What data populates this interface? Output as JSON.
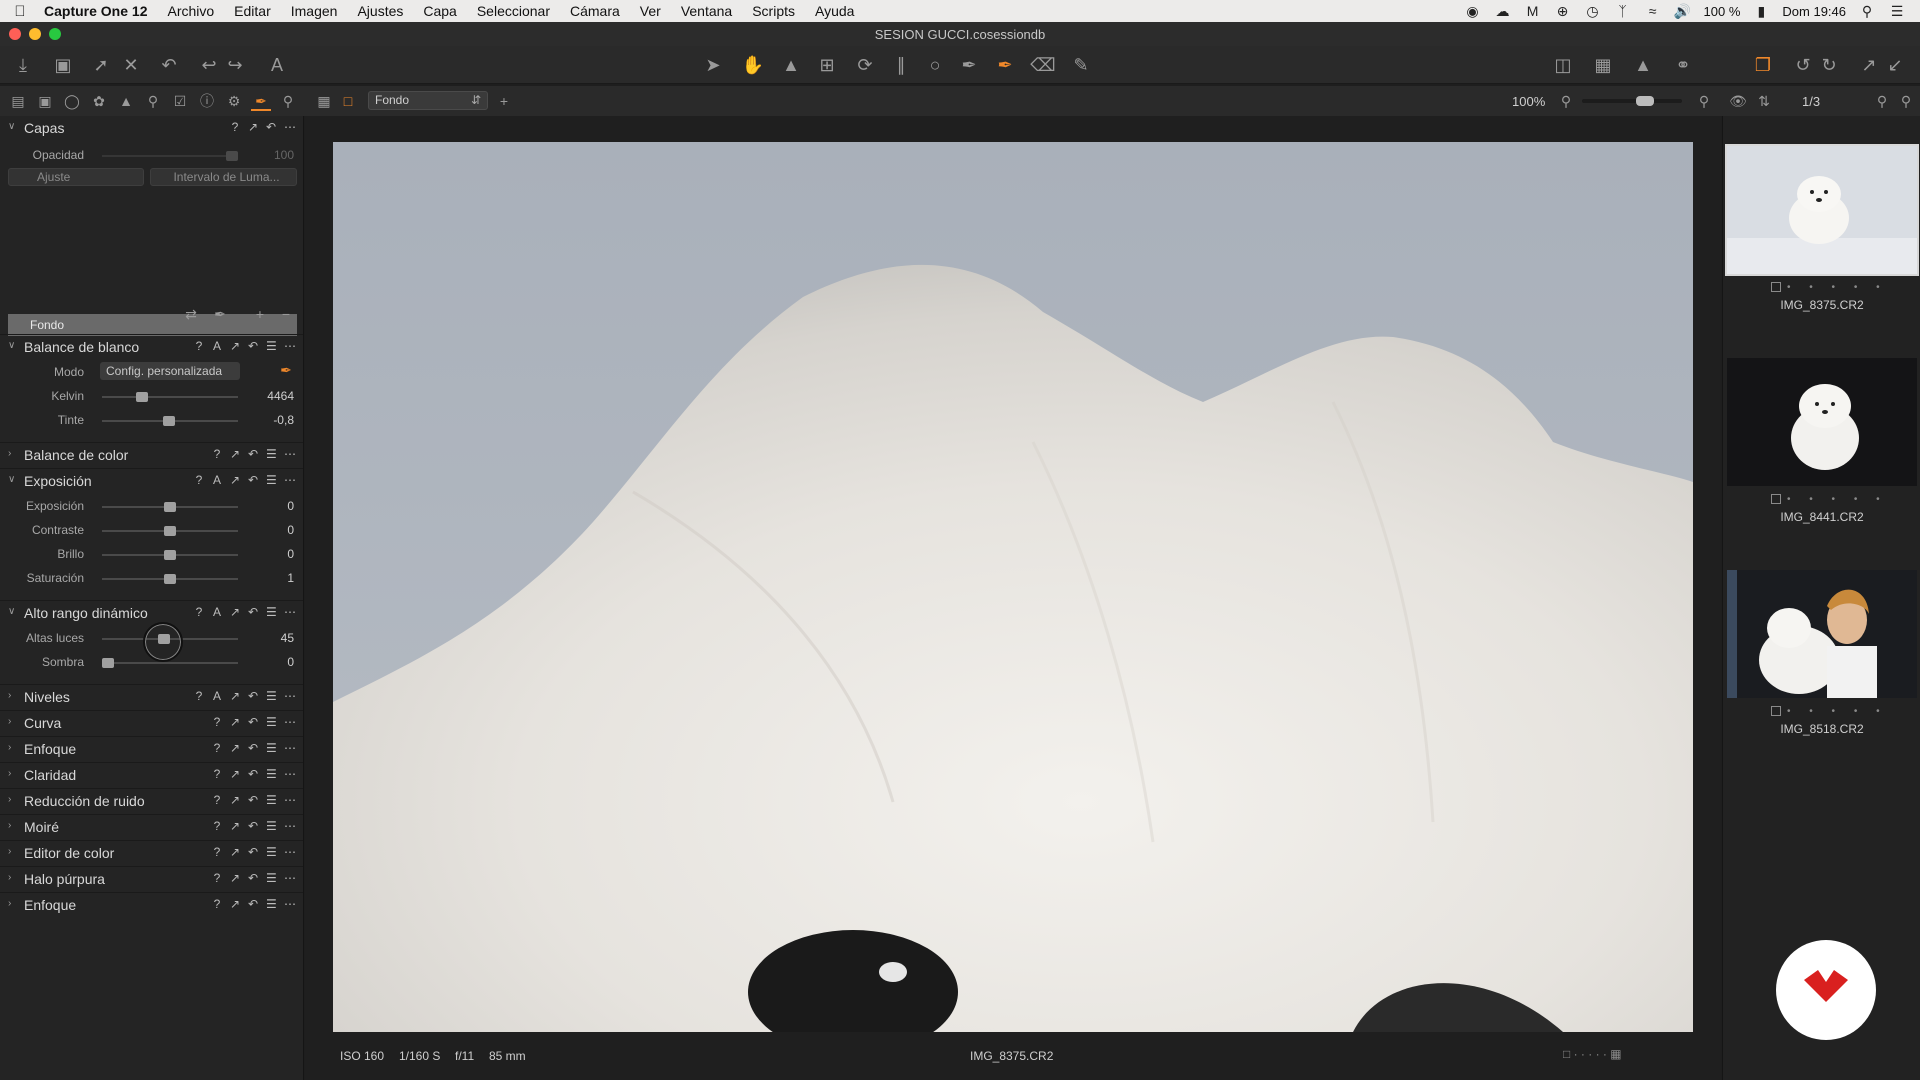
{
  "menubar": {
    "app_name": "Capture One 12",
    "items": [
      "Archivo",
      "Editar",
      "Imagen",
      "Ajustes",
      "Capa",
      "Seleccionar",
      "Cámara",
      "Ver",
      "Ventana",
      "Scripts",
      "Ayuda"
    ],
    "battery": "100 %",
    "clock": "Dom 19:46"
  },
  "window": {
    "title": "SESION GUCCI.cosessiondb"
  },
  "subbar": {
    "variant": "Fondo",
    "zoom": "100%",
    "counter": "1/3"
  },
  "panel": {
    "capas": {
      "title": "Capas",
      "opacity_label": "Opacidad",
      "opacity_value": "100",
      "adjust_dd": "Ajuste",
      "luma_dd": "Intervalo de Luma...",
      "layer": "Fondo"
    },
    "wb": {
      "title": "Balance de blanco",
      "mode_label": "Modo",
      "mode_value": "Config. personalizada",
      "kelvin_label": "Kelvin",
      "kelvin_value": "4464",
      "tint_label": "Tinte",
      "tint_value": "-0,8"
    },
    "color_balance": {
      "title": "Balance de color"
    },
    "exposure": {
      "title": "Exposición",
      "rows": [
        {
          "label": "Exposición",
          "value": "0"
        },
        {
          "label": "Contraste",
          "value": "0"
        },
        {
          "label": "Brillo",
          "value": "0"
        },
        {
          "label": "Saturación",
          "value": "1"
        }
      ]
    },
    "hdr": {
      "title": "Alto rango dinámico",
      "rows": [
        {
          "label": "Altas luces",
          "value": "45"
        },
        {
          "label": "Sombra",
          "value": "0"
        }
      ]
    },
    "collapsed": [
      {
        "title": "Niveles",
        "auto": true
      },
      {
        "title": "Curva",
        "auto": false
      },
      {
        "title": "Enfoque",
        "auto": false
      },
      {
        "title": "Claridad",
        "auto": false
      },
      {
        "title": "Reducción de ruido",
        "auto": false
      },
      {
        "title": "Moiré",
        "auto": false
      },
      {
        "title": "Editor de color",
        "auto": false
      },
      {
        "title": "Halo púrpura",
        "auto": false
      },
      {
        "title": "Enfoque",
        "auto": false
      }
    ]
  },
  "viewer": {
    "iso": "ISO 160",
    "shutter": "1/160 S",
    "aperture": "f/11",
    "focal": "85 mm",
    "filename": "IMG_8375.CR2"
  },
  "browser": {
    "thumbs": [
      {
        "name": "IMG_8375.CR2"
      },
      {
        "name": "IMG_8441.CR2"
      },
      {
        "name": "IMG_8518.CR2"
      }
    ]
  },
  "colors": {
    "accent": "#f0882a",
    "logo_red": "#d9201f"
  }
}
